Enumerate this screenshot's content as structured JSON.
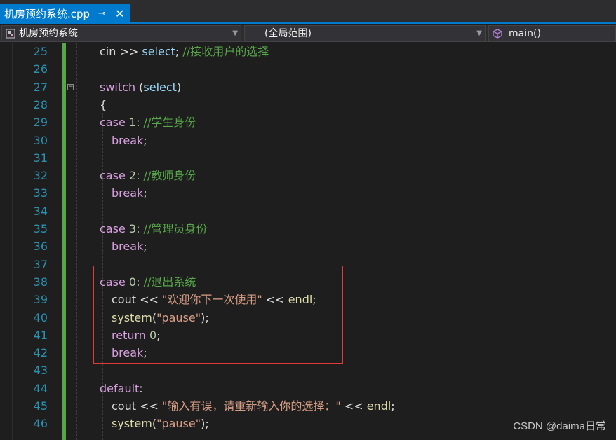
{
  "tab": {
    "title": "机房预约系统.cpp",
    "pin_icon": "pin-icon",
    "close_icon": "close-icon"
  },
  "nav": {
    "project": "机房预约系统",
    "scope": "(全局范围)",
    "member": "main()"
  },
  "lines": [
    {
      "n": "25",
      "indent": 0,
      "tokens": [
        {
          "t": "cin >> ",
          "c": "k-plain"
        },
        {
          "t": "select",
          "c": "k-var"
        },
        {
          "t": "; ",
          "c": "k-plain"
        },
        {
          "t": "//接收用户的选择",
          "c": "k-cmt"
        }
      ]
    },
    {
      "n": "26",
      "indent": 0,
      "tokens": []
    },
    {
      "n": "27",
      "indent": 0,
      "fold": true,
      "tokens": [
        {
          "t": "switch",
          "c": "k-ctrl"
        },
        {
          "t": " (",
          "c": "k-plain"
        },
        {
          "t": "select",
          "c": "k-var"
        },
        {
          "t": ")",
          "c": "k-plain"
        }
      ]
    },
    {
      "n": "28",
      "indent": 0,
      "tokens": [
        {
          "t": "{",
          "c": "k-plain"
        }
      ]
    },
    {
      "n": "29",
      "indent": 0,
      "tokens": [
        {
          "t": "case",
          "c": "k-ctrl"
        },
        {
          "t": " ",
          "c": "k-plain"
        },
        {
          "t": "1",
          "c": "k-num"
        },
        {
          "t": ": ",
          "c": "k-plain"
        },
        {
          "t": "//学生身份",
          "c": "k-cmt"
        }
      ]
    },
    {
      "n": "30",
      "indent": 1,
      "tokens": [
        {
          "t": "break",
          "c": "k-ctrl"
        },
        {
          "t": ";",
          "c": "k-plain"
        }
      ]
    },
    {
      "n": "31",
      "indent": 0,
      "tokens": []
    },
    {
      "n": "32",
      "indent": 0,
      "tokens": [
        {
          "t": "case",
          "c": "k-ctrl"
        },
        {
          "t": " ",
          "c": "k-plain"
        },
        {
          "t": "2",
          "c": "k-num"
        },
        {
          "t": ": ",
          "c": "k-plain"
        },
        {
          "t": "//教师身份",
          "c": "k-cmt"
        }
      ]
    },
    {
      "n": "33",
      "indent": 1,
      "tokens": [
        {
          "t": "break",
          "c": "k-ctrl"
        },
        {
          "t": ";",
          "c": "k-plain"
        }
      ]
    },
    {
      "n": "34",
      "indent": 0,
      "tokens": []
    },
    {
      "n": "35",
      "indent": 0,
      "tokens": [
        {
          "t": "case",
          "c": "k-ctrl"
        },
        {
          "t": " ",
          "c": "k-plain"
        },
        {
          "t": "3",
          "c": "k-num"
        },
        {
          "t": ": ",
          "c": "k-plain"
        },
        {
          "t": "//管理员身份",
          "c": "k-cmt"
        }
      ]
    },
    {
      "n": "36",
      "indent": 1,
      "tokens": [
        {
          "t": "break",
          "c": "k-ctrl"
        },
        {
          "t": ";",
          "c": "k-plain"
        }
      ]
    },
    {
      "n": "37",
      "indent": 0,
      "tokens": []
    },
    {
      "n": "38",
      "indent": 0,
      "tokens": [
        {
          "t": "case",
          "c": "k-ctrl"
        },
        {
          "t": " ",
          "c": "k-plain"
        },
        {
          "t": "0",
          "c": "k-num"
        },
        {
          "t": ": ",
          "c": "k-plain"
        },
        {
          "t": "//退出系统",
          "c": "k-cmt"
        }
      ]
    },
    {
      "n": "39",
      "indent": 1,
      "tokens": [
        {
          "t": "cout << ",
          "c": "k-plain"
        },
        {
          "t": "\"欢迎你下一次使用\"",
          "c": "k-str"
        },
        {
          "t": " << ",
          "c": "k-plain"
        },
        {
          "t": "endl",
          "c": "k-fn"
        },
        {
          "t": ";",
          "c": "k-plain"
        }
      ]
    },
    {
      "n": "40",
      "indent": 1,
      "tokens": [
        {
          "t": "system",
          "c": "k-fn"
        },
        {
          "t": "(",
          "c": "k-plain"
        },
        {
          "t": "\"pause\"",
          "c": "k-str"
        },
        {
          "t": ");",
          "c": "k-plain"
        }
      ]
    },
    {
      "n": "41",
      "indent": 1,
      "tokens": [
        {
          "t": "return",
          "c": "k-ctrl"
        },
        {
          "t": " ",
          "c": "k-plain"
        },
        {
          "t": "0",
          "c": "k-num"
        },
        {
          "t": ";",
          "c": "k-plain"
        }
      ]
    },
    {
      "n": "42",
      "indent": 1,
      "tokens": [
        {
          "t": "break",
          "c": "k-ctrl"
        },
        {
          "t": ";",
          "c": "k-plain"
        }
      ]
    },
    {
      "n": "43",
      "indent": 0,
      "tokens": []
    },
    {
      "n": "44",
      "indent": 0,
      "tokens": [
        {
          "t": "default",
          "c": "k-ctrl"
        },
        {
          "t": ":",
          "c": "k-plain"
        }
      ]
    },
    {
      "n": "45",
      "indent": 1,
      "tokens": [
        {
          "t": "cout << ",
          "c": "k-plain"
        },
        {
          "t": "\"输入有误，请重新输入你的选择：\"",
          "c": "k-str"
        },
        {
          "t": " << ",
          "c": "k-plain"
        },
        {
          "t": "endl",
          "c": "k-fn"
        },
        {
          "t": ";",
          "c": "k-plain"
        }
      ]
    },
    {
      "n": "46",
      "indent": 1,
      "tokens": [
        {
          "t": "system",
          "c": "k-fn"
        },
        {
          "t": "(",
          "c": "k-plain"
        },
        {
          "t": "\"pause\"",
          "c": "k-str"
        },
        {
          "t": ");",
          "c": "k-plain"
        }
      ]
    }
  ],
  "watermark": "CSDN @daima日常",
  "colors": {
    "accent": "#007acc",
    "highlight_border": "#e03a3a",
    "change_bar": "#57a64a"
  }
}
